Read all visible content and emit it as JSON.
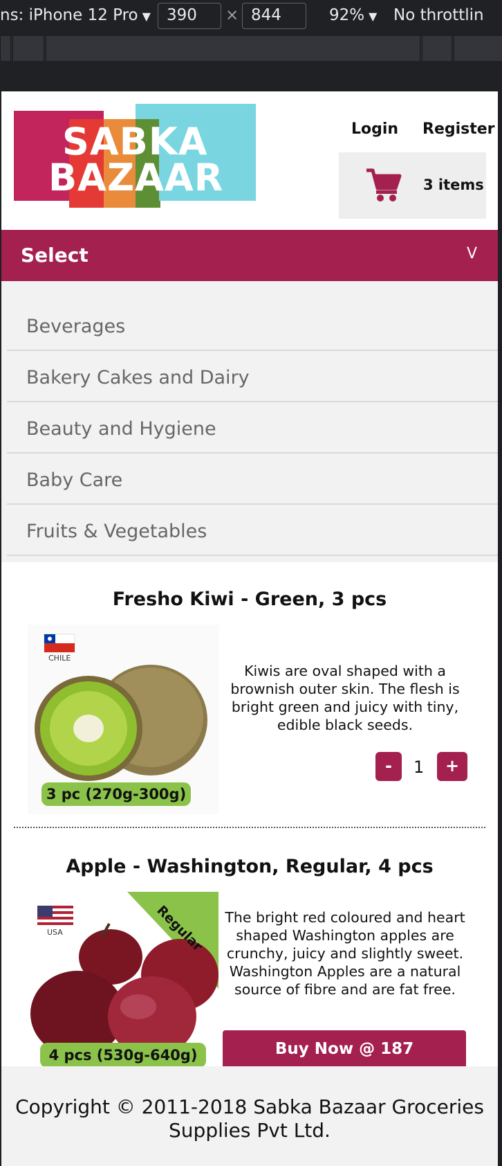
{
  "devtools": {
    "device": "ns: iPhone 12 Pro",
    "width": "390",
    "times": "×",
    "height": "844",
    "zoom": "92%",
    "throttling": "No throttlin"
  },
  "logo": {
    "line1": "SABKA",
    "line2": "BAZAAR"
  },
  "header": {
    "login": "Login",
    "register": "Register",
    "cart_count": "3 items"
  },
  "select": {
    "label": "Select",
    "caret": "V"
  },
  "categories": [
    "Beverages",
    "Bakery Cakes and Dairy",
    "Beauty and Hygiene",
    "Baby Care",
    "Fruits & Vegetables"
  ],
  "products": [
    {
      "title": "Fresho Kiwi - Green, 3 pcs",
      "flag_label": "CHILE",
      "pack": "3 pc (270g-300g)",
      "description": "Kiwis are oval shaped with a brownish outer skin. The flesh is bright green and juicy with tiny, edible black seeds.",
      "minus": "-",
      "quantity": "1",
      "plus": "+"
    },
    {
      "title": "Apple - Washington, Regular, 4 pcs",
      "flag_label": "USA",
      "ribbon": "Regular",
      "pack": "4 pcs (530g-640g)",
      "description": "The bright red coloured and heart shaped Washington apples are crunchy, juicy and slightly sweet. Washington Apples are a natural source of fibre and are fat free.",
      "buy": "Buy Now @ 187"
    }
  ],
  "footer": {
    "copyright": "Copyright © 2011-2018 Sabka Bazaar Groceries Supplies Pvt Ltd."
  },
  "colors": {
    "brand": "#a3204f",
    "panel": "#f2f2f2",
    "pill": "#8bc34a"
  }
}
